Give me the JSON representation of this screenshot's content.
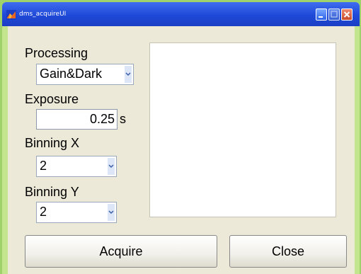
{
  "window": {
    "title": "dms_acquireUI",
    "icon": "matlab-figure-icon",
    "controls": [
      "minimize-icon",
      "maximize-icon",
      "close-icon"
    ]
  },
  "form": {
    "processing_label": "Processing",
    "processing_value": "Gain&Dark",
    "exposure_label": "Exposure",
    "exposure_value": "0.25",
    "exposure_unit": "s",
    "binning_x_label": "Binning X",
    "binning_x_value": "2",
    "binning_y_label": "Binning Y",
    "binning_y_value": "2"
  },
  "buttons": {
    "acquire_label": "Acquire",
    "close_label": "Close"
  },
  "colors": {
    "desktop": "#9fd26a",
    "titlebar": "#1f49d8",
    "panel": "#ece9d8"
  }
}
